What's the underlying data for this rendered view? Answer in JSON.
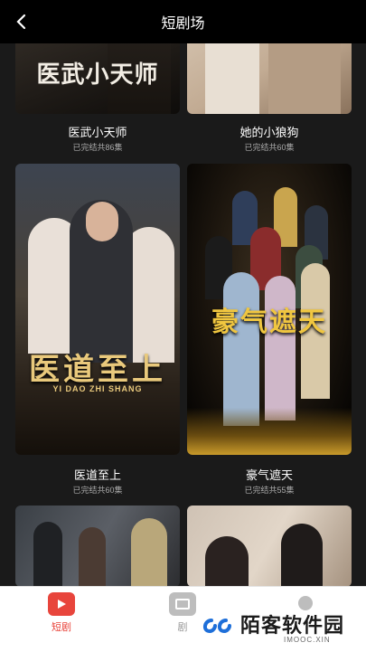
{
  "header": {
    "title": "短剧场"
  },
  "dramas": [
    {
      "title": "医武小天师",
      "status": "已完结共86集",
      "poster_text": "医武小天师"
    },
    {
      "title": "她的小狼狗",
      "status": "已完结共60集"
    },
    {
      "title": "医道至上",
      "status": "已完结共60集",
      "poster_text": "医道至上",
      "poster_subtext": "YI DAO ZHI SHANG"
    },
    {
      "title": "豪气遮天",
      "status": "已完结共55集",
      "poster_text": "豪气遮天"
    }
  ],
  "tabbar": {
    "tabs": [
      {
        "label": "短剧",
        "active": true
      },
      {
        "label": "剧"
      }
    ]
  },
  "watermark": {
    "name": "陌客软件园",
    "sub": "IMOOC.XIN"
  },
  "colors": {
    "accent": "#e8453c",
    "header_bg": "#000000",
    "page_bg": "#1a1a1a"
  }
}
